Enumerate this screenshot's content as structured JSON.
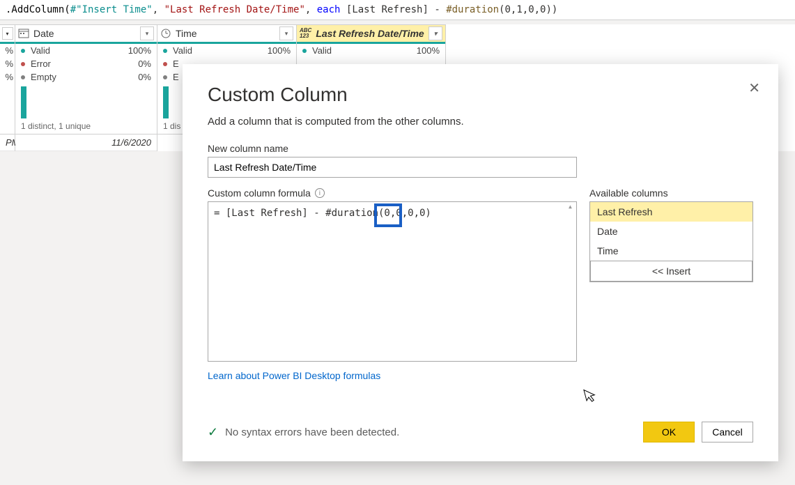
{
  "formula_bar": {
    "prefix": ".AddColumn(",
    "arg1": "#\"Insert Time\"",
    "sep1": ", ",
    "arg2": "\"Last Refresh Date/Time\"",
    "sep2": ", ",
    "kw": "each",
    "bracket": " [Last Refresh] - ",
    "hash": "#duration",
    "nums": "(0,1,0,0))"
  },
  "columns": {
    "prefix_pct": [
      "%",
      "%",
      "%"
    ],
    "col1": {
      "name": "Date",
      "valid_label": "Valid",
      "valid_pct": "100%",
      "error_label": "Error",
      "error_pct": "0%",
      "empty_label": "Empty",
      "empty_pct": "0%",
      "footer": "1 distinct, 1 unique",
      "data": "11/6/2020"
    },
    "col2": {
      "name": "Time",
      "valid_label": "Valid",
      "valid_pct": "100%",
      "footer": "1 dis",
      "e1": "E",
      "e2": "E"
    },
    "col3": {
      "name": "Last Refresh Date/Time",
      "valid_label": "Valid",
      "valid_pct": "100%",
      "type_prefix": "ABC",
      "type_sub": "123"
    },
    "row_label": "PM"
  },
  "dialog": {
    "title": "Custom Column",
    "desc": "Add a column that is computed from the other columns.",
    "name_label": "New column name",
    "name_value": "Last Refresh Date/Time",
    "formula_label": "Custom column formula",
    "formula_value": "= [Last Refresh] - #duration(0,0,0,0)",
    "avail_label": "Available columns",
    "avail_items": [
      "Last Refresh",
      "Date",
      "Time"
    ],
    "insert_label": "<< Insert",
    "learn_link": "Learn about Power BI Desktop formulas",
    "syntax_msg": "No syntax errors have been detected.",
    "ok": "OK",
    "cancel": "Cancel"
  }
}
